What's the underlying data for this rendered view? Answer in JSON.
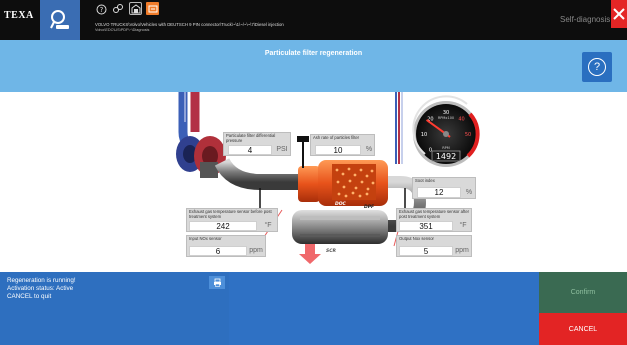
{
  "topbar": {
    "brand": "TEXA",
    "breadcrumb_line1": "VOLVO TRUCKS\\Volvo\\Vehicles with DEUTSCH 9 PIN connector\\Truck\\~\\1\\~/~\\~\\7\\Diesel injection",
    "breadcrumb_line2": "Volvo\\EDC\\US\\PDF\\~\\Diagnosis",
    "self_diagnosis_label": "Self-diagnosis DEMO"
  },
  "title": "Particulate filter regeneration",
  "sensors": {
    "pf_diff_pressure": {
      "label": "Particulate filter differential pressure",
      "value": "4",
      "unit": "PSI"
    },
    "ash_rate": {
      "label": "Ash rate of particles filter",
      "value": "10",
      "unit": "%"
    },
    "soot_index": {
      "label": "Soot index",
      "value": "12",
      "unit": "%"
    },
    "exhaust_temp_before": {
      "label": "Exhaust gas temperature sensor before post treatment system",
      "value": "242",
      "unit": "°F"
    },
    "exhaust_temp_after": {
      "label": "Exhaust gas temperature sensor after post treatment system",
      "value": "351",
      "unit": "°F"
    },
    "input_nox": {
      "label": "Input NOx sensor",
      "value": "6",
      "unit": "ppm"
    },
    "output_nox": {
      "label": "Output Nox sensor",
      "value": "5",
      "unit": "ppm"
    }
  },
  "gauge": {
    "rpm": "1492",
    "rpm_label": "RPM",
    "unit_label": "RPMx100",
    "scale_labels": [
      "10",
      "20",
      "30",
      "40",
      "50"
    ],
    "scale_values": [
      10,
      20,
      30,
      40,
      50
    ],
    "zero_label": "0",
    "value_fraction": 0.3
  },
  "component_labels": {
    "doc": "DOC",
    "dpf": "DPF",
    "scr": "SCR"
  },
  "status_lines": [
    "Regeneration is running!",
    "Activation status: Active",
    "CANCEL to quit"
  ],
  "buttons": {
    "confirm": "Confirm",
    "cancel": "CANCEL"
  },
  "colors": {
    "accent_blue": "#2f71c4",
    "title_band": "#6fb6e7",
    "cancel_red": "#e32424",
    "confirm_green": "#3a6a52",
    "texa_orange": "#f07c2a"
  }
}
